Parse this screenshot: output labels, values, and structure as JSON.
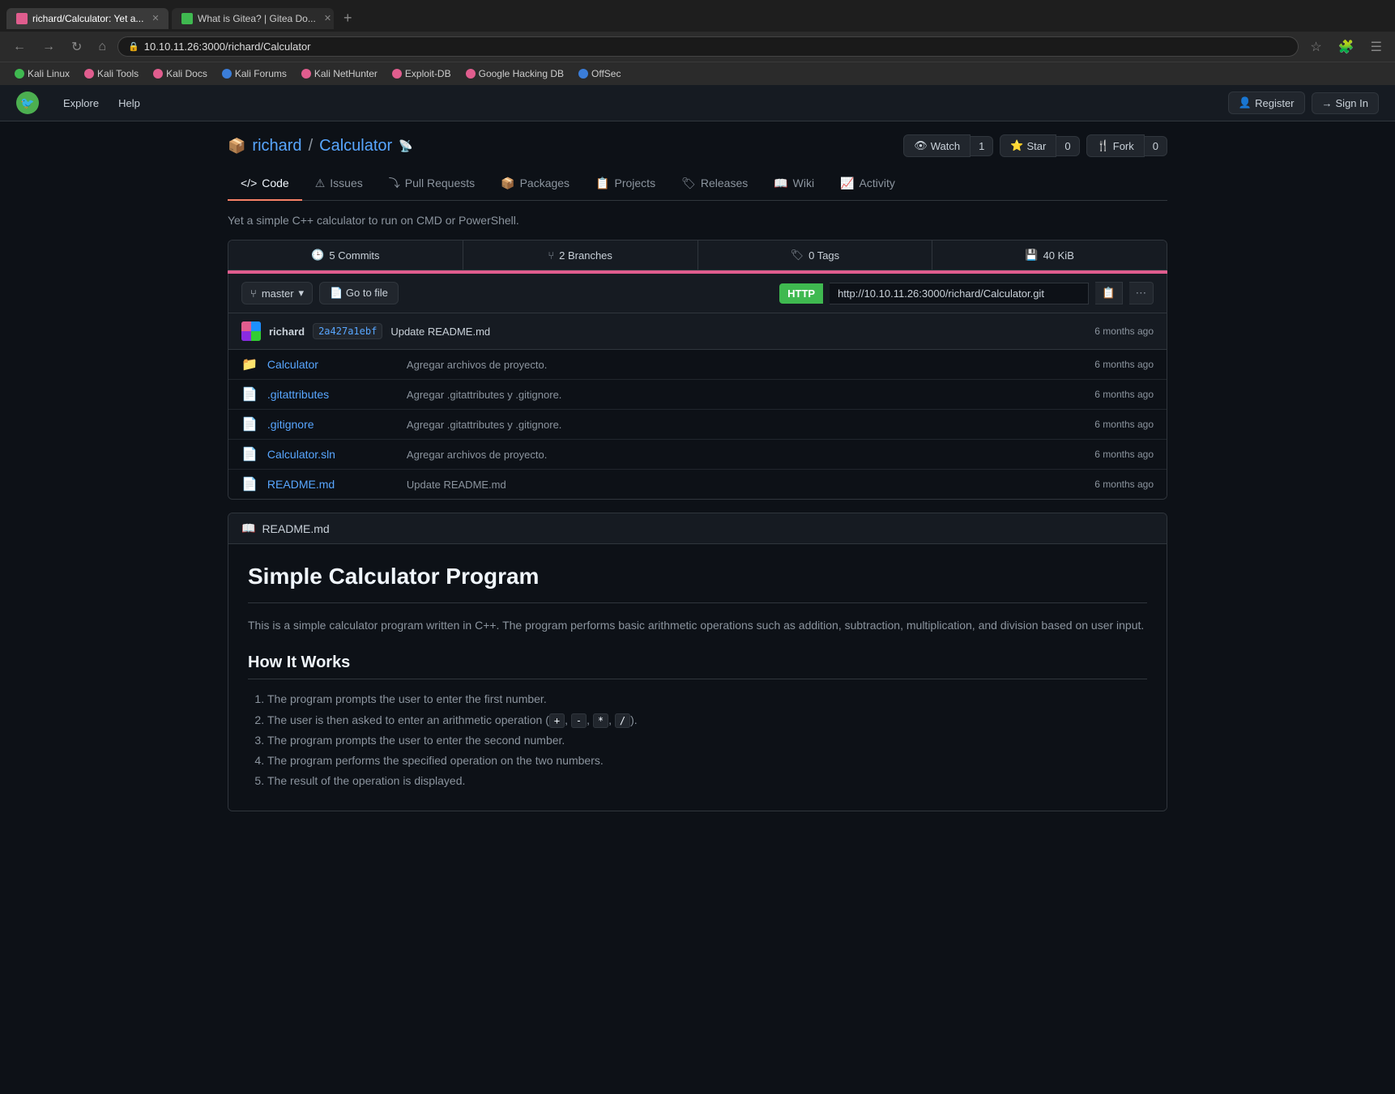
{
  "browser": {
    "tabs": [
      {
        "label": "richard/Calculator: Yet a...",
        "active": true,
        "favicon_color": "#e05d8e"
      },
      {
        "label": "What is Gitea? | Gitea Do...",
        "active": false,
        "favicon_color": "#3fb950"
      }
    ],
    "address": "10.10.11.26:3000/richard/Calculator",
    "bookmarks": [
      {
        "label": "Kali Linux",
        "color": "#3fb950"
      },
      {
        "label": "Kali Tools",
        "color": "#e05d8e"
      },
      {
        "label": "Kali Docs",
        "color": "#e05d8e"
      },
      {
        "label": "Kali Forums",
        "color": "#3b7dd8"
      },
      {
        "label": "Kali NetHunter",
        "color": "#e05d8e"
      },
      {
        "label": "Exploit-DB",
        "color": "#e05d8e"
      },
      {
        "label": "Google Hacking DB",
        "color": "#e05d8e"
      },
      {
        "label": "OffSec",
        "color": "#3b7dd8"
      }
    ]
  },
  "gitea": {
    "nav": {
      "explore_label": "Explore",
      "help_label": "Help",
      "register_label": "Register",
      "sign_in_label": "Sign In"
    },
    "repo": {
      "owner": "richard",
      "name": "Calculator",
      "description": "Yet a simple C++ calculator to run on CMD or PowerShell.",
      "stats": {
        "commits_label": "5 Commits",
        "branches_label": "2 Branches",
        "tags_label": "0 Tags",
        "size_label": "40 KiB"
      },
      "actions": {
        "watch_label": "Watch",
        "watch_count": "1",
        "star_label": "Star",
        "star_count": "0",
        "fork_label": "Fork",
        "fork_count": "0"
      },
      "tabs": [
        {
          "label": "Code",
          "icon": "</>",
          "active": true
        },
        {
          "label": "Issues",
          "active": false
        },
        {
          "label": "Pull Requests",
          "active": false
        },
        {
          "label": "Packages",
          "active": false
        },
        {
          "label": "Projects",
          "active": false
        },
        {
          "label": "Releases",
          "active": false
        },
        {
          "label": "Wiki",
          "active": false
        },
        {
          "label": "Activity",
          "active": false
        }
      ],
      "branch": "master",
      "branch_btn_label": "master",
      "go_to_file_label": "Go to file",
      "http_label": "HTTP",
      "clone_url": "http://10.10.11.26:3000/richard/Calculator.git",
      "commit": {
        "author": "richard",
        "hash": "2a427a1ebf",
        "message": "Update README.md",
        "time": "6 months ago"
      },
      "files": [
        {
          "type": "folder",
          "name": "Calculator",
          "commit_msg": "Agregar archivos de proyecto.",
          "time": "6 months ago"
        },
        {
          "type": "file",
          "name": ".gitattributes",
          "commit_msg": "Agregar .gitattributes y .gitignore.",
          "time": "6 months ago"
        },
        {
          "type": "file",
          "name": ".gitignore",
          "commit_msg": "Agregar .gitattributes y .gitignore.",
          "time": "6 months ago"
        },
        {
          "type": "file",
          "name": "Calculator.sln",
          "commit_msg": "Agregar archivos de proyecto.",
          "time": "6 months ago"
        },
        {
          "type": "file",
          "name": "README.md",
          "commit_msg": "Update README.md",
          "time": "6 months ago"
        }
      ],
      "readme": {
        "filename": "README.md",
        "title": "Simple Calculator Program",
        "intro": "This is a simple calculator program written in C++. The program performs basic arithmetic operations such as addition, subtraction, multiplication, and division based on user input.",
        "how_it_works_title": "How It Works",
        "steps": [
          "The program prompts the user to enter the first number.",
          "The user is then asked to enter an arithmetic operation (+, -, *, /).",
          "The program prompts the user to enter the second number.",
          "The program performs the specified operation on the two numbers.",
          "The result of the operation is displayed."
        ],
        "step_codes": [
          "+",
          "-",
          "*",
          "/"
        ]
      }
    }
  }
}
